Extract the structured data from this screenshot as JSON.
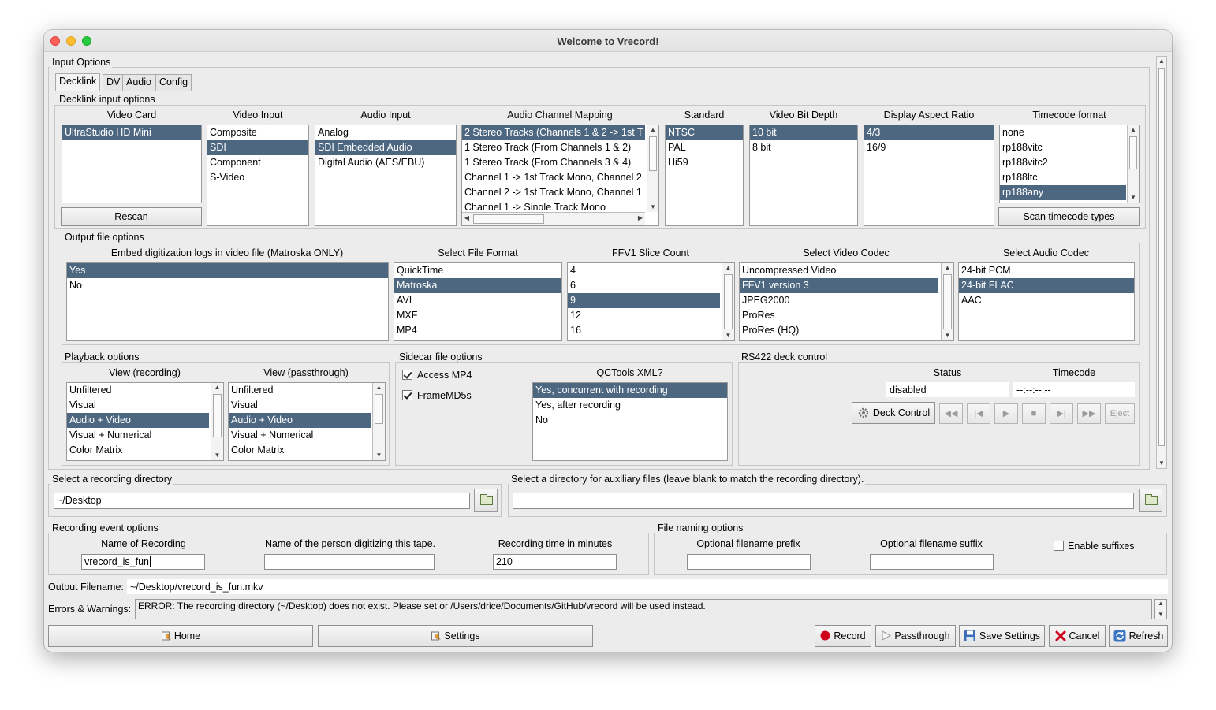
{
  "window": {
    "title": "Welcome to Vrecord!"
  },
  "input_options": {
    "legend": "Input Options",
    "tabs": [
      "Decklink",
      "DV",
      "Audio",
      "Config"
    ],
    "active_tab": "Decklink",
    "decklink_legend": "Decklink input options",
    "video_card": {
      "label": "Video Card",
      "items": [
        "UltraStudio HD Mini"
      ],
      "selected": 0,
      "rescan_label": "Rescan"
    },
    "video_input": {
      "label": "Video Input",
      "items": [
        "Composite",
        "SDI",
        "Component",
        "S-Video"
      ],
      "selected": 1
    },
    "audio_input": {
      "label": "Audio Input",
      "items": [
        "Analog",
        "SDI Embedded Audio",
        "Digital Audio (AES/EBU)"
      ],
      "selected": 1
    },
    "audio_channel_mapping": {
      "label": "Audio Channel Mapping",
      "items": [
        "2 Stereo Tracks (Channels 1 & 2 -> 1st T",
        "1 Stereo Track (From Channels 1 & 2)",
        "1 Stereo Track (From Channels 3 & 4)",
        "Channel 1 -> 1st Track Mono, Channel 2",
        "Channel 2 -> 1st Track Mono, Channel 1",
        "Channel 1 -> Single Track Mono"
      ],
      "selected": 0
    },
    "standard": {
      "label": "Standard",
      "items": [
        "NTSC",
        "PAL",
        "Hi59"
      ],
      "selected": 0
    },
    "video_bit_depth": {
      "label": "Video Bit Depth",
      "items": [
        "10 bit",
        "8 bit"
      ],
      "selected": 0
    },
    "display_aspect_ratio": {
      "label": "Display Aspect Ratio",
      "items": [
        "4/3",
        "16/9"
      ],
      "selected": 0
    },
    "timecode_format": {
      "label": "Timecode format",
      "items": [
        "none",
        "rp188vitc",
        "rp188vitc2",
        "rp188ltc",
        "rp188any"
      ],
      "selected": 4,
      "scan_label": "Scan timecode types"
    }
  },
  "output_file_options": {
    "legend": "Output file options",
    "embed_logs": {
      "label": "Embed digitization logs in video file (Matroska ONLY)",
      "items": [
        "Yes",
        "No"
      ],
      "selected": 0
    },
    "file_format": {
      "label": "Select File Format",
      "items": [
        "QuickTime",
        "Matroska",
        "AVI",
        "MXF",
        "MP4"
      ],
      "selected": 1
    },
    "ffv1_slice_count": {
      "label": "FFV1 Slice Count",
      "items": [
        "4",
        "6",
        "9",
        "12",
        "16"
      ],
      "selected": 2
    },
    "video_codec": {
      "label": "Select Video Codec",
      "items": [
        "Uncompressed Video",
        "FFV1 version 3",
        "JPEG2000",
        "ProRes",
        "ProRes (HQ)"
      ],
      "selected": 1
    },
    "audio_codec": {
      "label": "Select Audio Codec",
      "items": [
        "24-bit PCM",
        "24-bit FLAC",
        "AAC"
      ],
      "selected": 1
    }
  },
  "playback_options": {
    "legend": "Playback options",
    "view_recording": {
      "label": "View (recording)",
      "items": [
        "Unfiltered",
        "Visual",
        "Audio + Video",
        "Visual + Numerical",
        "Color Matrix"
      ],
      "selected": 2
    },
    "view_passthrough": {
      "label": "View (passthrough)",
      "items": [
        "Unfiltered",
        "Visual",
        "Audio + Video",
        "Visual + Numerical",
        "Color Matrix"
      ],
      "selected": 2
    }
  },
  "sidecar_options": {
    "legend": "Sidecar file options",
    "access_mp4": "Access MP4",
    "framemd5s": "FrameMD5s",
    "qctools": {
      "label": "QCTools XML?",
      "items": [
        "Yes, concurrent with recording",
        "Yes, after recording",
        "No"
      ],
      "selected": 0
    }
  },
  "deck_control": {
    "legend": "RS422 deck control",
    "status_label": "Status",
    "status_value": "disabled",
    "timecode_label": "Timecode",
    "timecode_value": "--:--:--:--",
    "deck_control_label": "Deck Control",
    "eject_label": "Eject"
  },
  "directories": {
    "recording_legend": "Select a recording directory",
    "recording_value": "~/Desktop",
    "aux_legend": "Select a directory for auxiliary files (leave blank to match the recording directory).",
    "aux_value": ""
  },
  "recording_event": {
    "legend": "Recording event options",
    "name_label": "Name of Recording",
    "name_value": "vrecord_is_fun",
    "person_label": "Name of the person digitizing this tape.",
    "person_value": "",
    "time_label": "Recording time in minutes",
    "time_value": "210"
  },
  "file_naming": {
    "legend": "File naming options",
    "prefix_label": "Optional filename prefix",
    "prefix_value": "",
    "suffix_label": "Optional filename suffix",
    "suffix_value": "",
    "enable_suffixes": "Enable suffixes"
  },
  "output": {
    "label": "Output Filename:",
    "value": "~/Desktop/vrecord_is_fun.mkv"
  },
  "errors": {
    "label": "Errors & Warnings:",
    "value": "ERROR: The recording directory (~/Desktop) does not exist. Please set or /Users/drice/Documents/GitHub/vrecord will be used instead."
  },
  "bottom_buttons": {
    "home": "Home",
    "settings": "Settings",
    "record": "Record",
    "passthrough": "Passthrough",
    "save_settings": "Save Settings",
    "cancel": "Cancel",
    "refresh": "Refresh"
  },
  "colors": {
    "selection": "#4d6781",
    "window_bg": "#ececec",
    "record": "#d0021b",
    "cancel": "#d0021b"
  }
}
